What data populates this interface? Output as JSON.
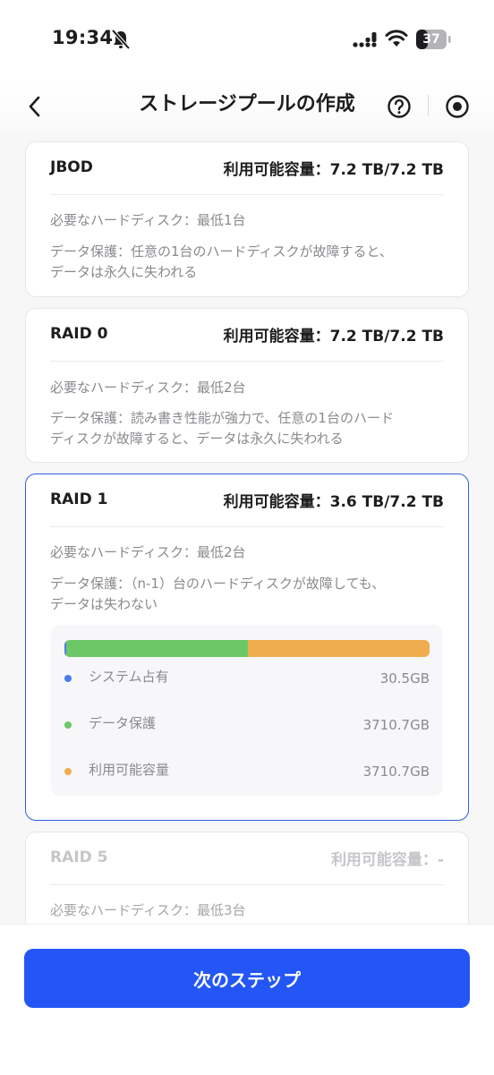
{
  "status_bar": {
    "time": "19:34",
    "battery": "37"
  },
  "header": {
    "title": "ストレージプールの作成"
  },
  "options": [
    {
      "title": "JBOD",
      "capacity": "利用可能容量：7.2 TB/7.2 TB",
      "min_disks": "必要なハードディスク：最低1台",
      "protection_line1": "データ保護：任意の1台のハードディスクが故障すると、",
      "protection_line2": "データは永久に失われる"
    },
    {
      "title": "RAID 0",
      "capacity": "利用可能容量：7.2 TB/7.2 TB",
      "min_disks": "必要なハードディスク：最低2台",
      "protection_line1": "データ保護：読み書き性能が強力で、任意の1台のハード",
      "protection_line2": "ディスクが故障すると、データは永久に失われる"
    },
    {
      "title": "RAID 1",
      "capacity": "利用可能容量：3.6 TB/7.2 TB",
      "min_disks": "必要なハードディスク：最低2台",
      "protection_line1": "データ保護：（n-1）台のハードディスクが故障しても、",
      "protection_line2": "データは失わない",
      "selected": true,
      "usage": [
        {
          "label": "システム占有",
          "value": "30.5GB",
          "amount_gb": 30.5,
          "color": "#4a7cf0"
        },
        {
          "label": "データ保護",
          "value": "3710.7GB",
          "amount_gb": 3710.7,
          "color": "#6cc867"
        },
        {
          "label": "利用可能容量",
          "value": "3710.7GB",
          "amount_gb": 3710.7,
          "color": "#f0ad4e"
        }
      ]
    },
    {
      "title": "RAID 5",
      "capacity": "利用可能容量：-",
      "min_disks": "必要なハードディスク：最低3台",
      "disabled": true
    }
  ],
  "footer": {
    "next_label": "次のステップ"
  },
  "colors": {
    "accent": "#2456f5",
    "selected_border": "#2f5fe0"
  }
}
